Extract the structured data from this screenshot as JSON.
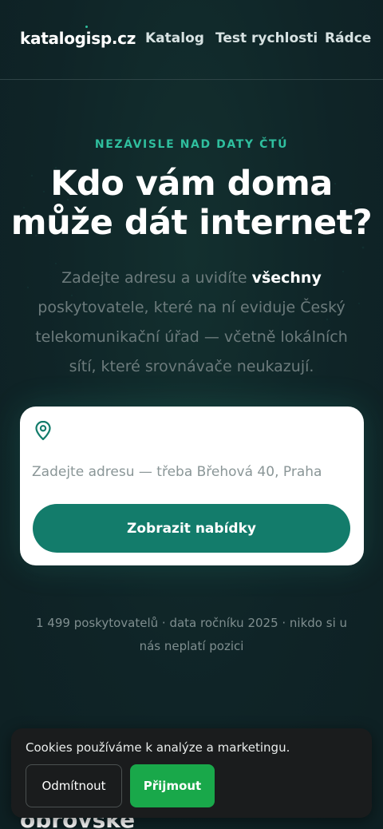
{
  "header": {
    "logo": "katalogisp.cz",
    "nav": {
      "katalog": "Katalog",
      "test_rychlosti": "Test rychlosti",
      "radce": "Rádce"
    }
  },
  "hero": {
    "eyebrow": "NEZÁVISLE NAD DATY ČTÚ",
    "title_line1": "Kdo vám doma",
    "title_line2": "může dát internet?",
    "subtitle_before": "Zadejte adresu a uvidíte ",
    "subtitle_strong": "všechny",
    "subtitle_after": " poskytovatele, které na ní eviduje Český telekomunikační úřad — včetně lokálních sítí, které srovnávače neukazují."
  },
  "search": {
    "placeholder": "Zadejte adresu — třeba Břehová 40, Praha",
    "value": "",
    "submit_label": "Zobrazit nabídky",
    "icon": "map-pin-icon"
  },
  "stats": {
    "text": "1 499 poskytovatelů · data ročníku 2025 · nikdo si u nás neplatí pozici"
  },
  "below": {
    "heading_partial": "obrovské"
  },
  "cookie": {
    "text": "Cookies používáme k analýze a marketingu.",
    "decline_label": "Odmítnout",
    "accept_label": "Přijmout"
  },
  "colors": {
    "background": "#0f2326",
    "accent": "#2fbf9e",
    "button": "#137c6b",
    "accept": "#19a84a"
  }
}
